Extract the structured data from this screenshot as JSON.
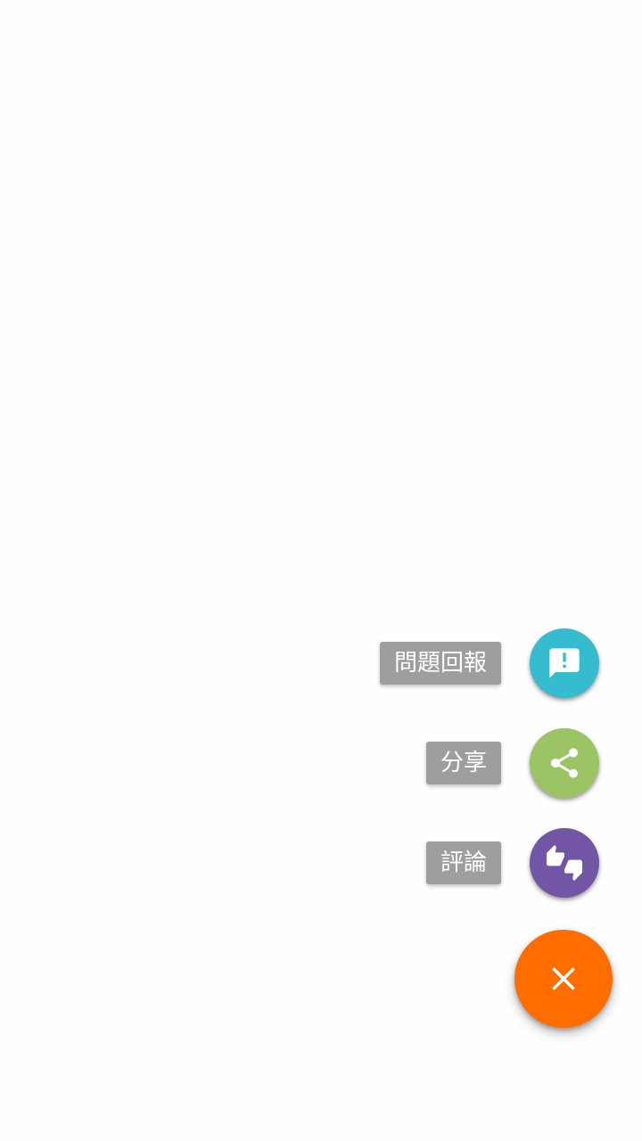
{
  "fab_menu": {
    "items": [
      {
        "label": "問題回報",
        "icon": "feedback-icon",
        "color": "#35bccf"
      },
      {
        "label": "分享",
        "icon": "share-icon",
        "color": "#9bc564"
      },
      {
        "label": "評論",
        "icon": "thumbs-up-down-icon",
        "color": "#7355a6"
      }
    ],
    "main": {
      "icon": "close-icon",
      "color": "#ff6d00"
    }
  }
}
